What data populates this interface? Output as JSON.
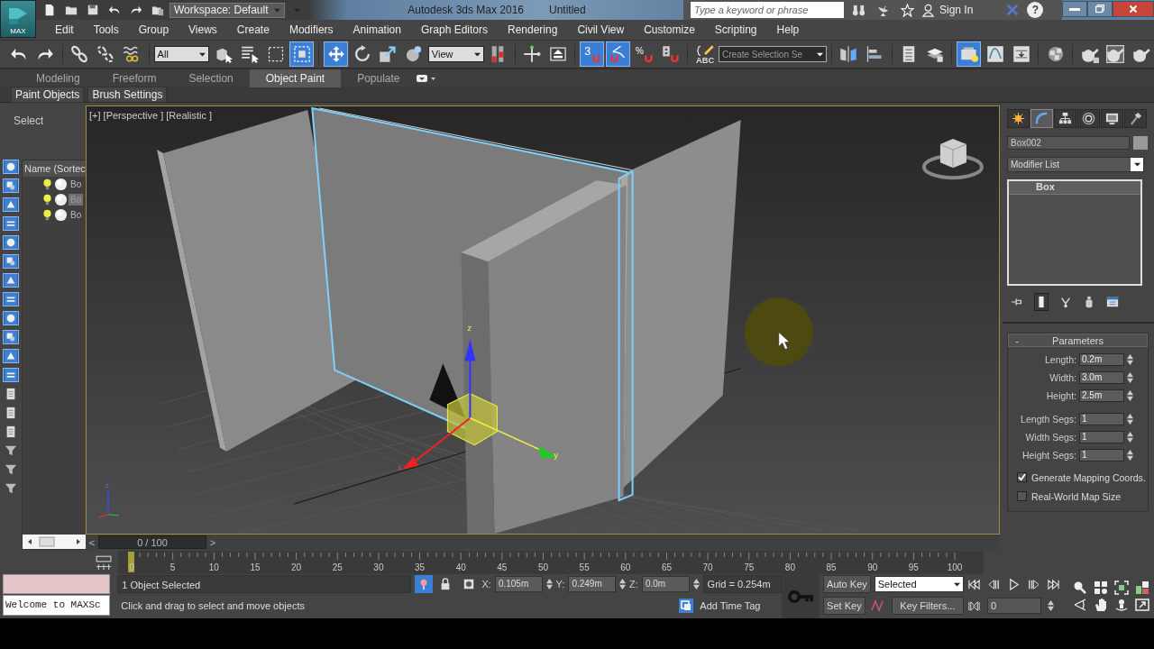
{
  "app_button": {
    "label": "MAX"
  },
  "title_bar": {
    "workspace": "Workspace: Default",
    "title": "Autodesk 3ds Max 2016",
    "document": "Untitled",
    "search": {
      "placeholder": "Type a keyword or phrase"
    },
    "sign_in": "Sign In",
    "help": "?"
  },
  "menu": [
    "Edit",
    "Tools",
    "Group",
    "Views",
    "Create",
    "Modifiers",
    "Animation",
    "Graph Editors",
    "Rendering",
    "Civil View",
    "Customize",
    "Scripting",
    "Help"
  ],
  "main_toolbar": [
    {
      "kind": "undo",
      "selected": false
    },
    {
      "kind": "redo",
      "selected": false
    },
    {
      "kind": "sep"
    },
    {
      "kind": "link",
      "selected": false
    },
    {
      "kind": "unlink",
      "selected": false
    },
    {
      "kind": "bind",
      "selected": false
    },
    {
      "kind": "sep"
    },
    {
      "kind": "dropdown",
      "value": "All"
    },
    {
      "kind": "select",
      "selected": false
    },
    {
      "kind": "select-name",
      "selected": false
    },
    {
      "kind": "region",
      "selected": false
    },
    {
      "kind": "crossing",
      "selected": true
    },
    {
      "kind": "sep"
    },
    {
      "kind": "move",
      "selected": true
    },
    {
      "kind": "rotate",
      "selected": false
    },
    {
      "kind": "scale",
      "selected": false
    },
    {
      "kind": "sphere",
      "selected": false
    },
    {
      "kind": "dropdown",
      "value": "View"
    },
    {
      "kind": "pivot",
      "selected": false
    },
    {
      "kind": "sep"
    },
    {
      "kind": "manipulate",
      "selected": false
    },
    {
      "kind": "shortcut",
      "selected": false
    },
    {
      "kind": "sep"
    },
    {
      "kind": "snap",
      "glyph": "3",
      "selected": true
    },
    {
      "kind": "angle-snap",
      "selected": true
    },
    {
      "kind": "percent-snap",
      "glyph": "%",
      "selected": false
    },
    {
      "kind": "spinner-snap",
      "selected": false
    },
    {
      "kind": "sep"
    },
    {
      "kind": "named-selection",
      "glyph": "ABC",
      "selected": false
    },
    {
      "kind": "dropdown",
      "value": "Create Selection Se"
    },
    {
      "kind": "sep"
    },
    {
      "kind": "mirror",
      "selected": false
    },
    {
      "kind": "align",
      "selected": false
    },
    {
      "kind": "sep"
    },
    {
      "kind": "explorer",
      "selected": false
    },
    {
      "kind": "layers",
      "selected": false
    },
    {
      "kind": "sep"
    },
    {
      "kind": "manage-layers",
      "selected": true
    },
    {
      "kind": "curve-editor",
      "selected": false
    },
    {
      "kind": "schematic",
      "selected": false
    },
    {
      "kind": "sep"
    },
    {
      "kind": "material",
      "selected": false
    },
    {
      "kind": "sep"
    },
    {
      "kind": "render-setup",
      "selected": false
    },
    {
      "kind": "render-frame",
      "selected": false
    },
    {
      "kind": "render",
      "selected": false
    }
  ],
  "ribbon": {
    "tabs": [
      {
        "label": "Modeling",
        "selected": false
      },
      {
        "label": "Freeform",
        "selected": false
      },
      {
        "label": "Selection",
        "selected": false
      },
      {
        "label": "Object Paint",
        "selected": true
      },
      {
        "label": "Populate",
        "selected": false
      }
    ],
    "panels": [
      "Paint Objects",
      "Brush Settings"
    ]
  },
  "scene_explorer": {
    "title": "Select",
    "column": "Name (Sortec",
    "tools": [
      {
        "kind": "filter",
        "on": true
      },
      {
        "kind": "filter",
        "on": true
      },
      {
        "kind": "filter",
        "on": true
      },
      {
        "kind": "filter",
        "on": true
      },
      {
        "kind": "filter",
        "on": true
      },
      {
        "kind": "filter",
        "on": true
      },
      {
        "kind": "filter",
        "on": true
      },
      {
        "kind": "filter",
        "on": true
      },
      {
        "kind": "filter",
        "on": true
      },
      {
        "kind": "filter",
        "on": true
      },
      {
        "kind": "filter",
        "on": true
      },
      {
        "kind": "filter",
        "on": true
      },
      {
        "kind": "list",
        "on": false
      },
      {
        "kind": "list",
        "on": false
      },
      {
        "kind": "list",
        "on": false
      },
      {
        "kind": "funnel",
        "on": false
      },
      {
        "kind": "funnel",
        "on": false
      },
      {
        "kind": "funnel",
        "on": false
      }
    ],
    "rows": [
      {
        "name": "Bo",
        "selected": false
      },
      {
        "name": "Bo",
        "selected": true
      },
      {
        "name": "Bo",
        "selected": false
      }
    ]
  },
  "viewport": {
    "label": "[+] [Perspective ] [Realistic ]",
    "gizmo_axes": [
      "z",
      "x",
      "y"
    ],
    "tripod_axis": "z"
  },
  "time_slider": {
    "prev": "<",
    "position": "0 / 100",
    "next": ">",
    "level": 0
  },
  "track_bar": {
    "labels": [
      "0",
      "5",
      "10",
      "15",
      "20",
      "25",
      "30",
      "35",
      "40",
      "45",
      "50",
      "55",
      "60",
      "65",
      "70",
      "75",
      "80",
      "85",
      "90",
      "95",
      "100"
    ]
  },
  "command_panel": {
    "tabs": [
      {
        "kind": "create",
        "selected": false
      },
      {
        "kind": "modify",
        "selected": true
      },
      {
        "kind": "hierarchy",
        "selected": false
      },
      {
        "kind": "motion",
        "selected": false
      },
      {
        "kind": "display",
        "selected": false
      },
      {
        "kind": "utilities",
        "selected": false
      }
    ],
    "object_name": "Box002",
    "modifier_list": "Modifier List",
    "stack": [
      {
        "label": "Box",
        "selected": true
      }
    ],
    "rollout": {
      "collapse": "-",
      "title": "Parameters",
      "fields": [
        {
          "label": "Length:",
          "value": "0.2m"
        },
        {
          "label": "Width:",
          "value": "3.0m"
        },
        {
          "label": "Height:",
          "value": "2.5m"
        },
        {
          "label": "Length Segs:",
          "value": "1"
        },
        {
          "label": "Width Segs:",
          "value": "1"
        },
        {
          "label": "Height Segs:",
          "value": "1"
        }
      ],
      "checkboxes": [
        {
          "label": "Generate Mapping Coords.",
          "checked": true
        },
        {
          "label": "Real-World Map Size",
          "checked": false
        }
      ]
    }
  },
  "status": {
    "listener": "Welcome to MAXSc",
    "selection": "1 Object Selected",
    "prompt": "Click and drag to select and move objects",
    "isolate": {
      "selected": true
    },
    "x_label": "X:",
    "x": "0.105m",
    "y_label": "Y:",
    "y": "0.249m",
    "z_label": "Z:",
    "z": "0.0m",
    "grid": "Grid = 0.254m",
    "time_tag": "Add Time Tag",
    "auto_key": "Auto Key",
    "key_mode": "Selected",
    "set_key": "Set Key",
    "key_filters": "Key Filters...",
    "frame": "0"
  }
}
